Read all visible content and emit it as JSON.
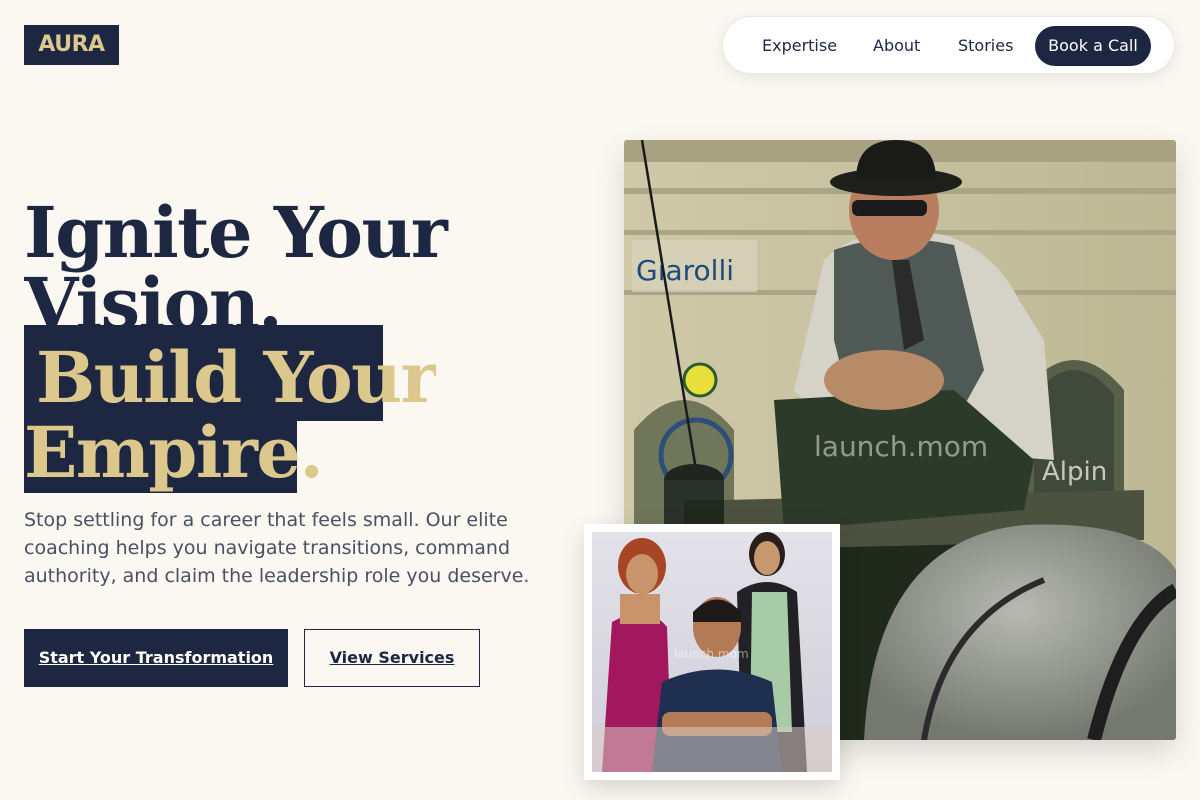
{
  "brand": {
    "logo": "AURA"
  },
  "nav": {
    "items": [
      "Expertise",
      "About",
      "Stories"
    ],
    "cta": "Book a Call"
  },
  "hero": {
    "headline_line1": "Ignite Your",
    "headline_line2": "Vision.",
    "highlight_line1": "Build Your",
    "highlight_line2": "Empire.",
    "description": "Stop settling for a career that feels small. Our elite coaching helps you navigate transitions, command authority, and claim the leadership role you deserve.",
    "primary_button": "Start Your Transformation",
    "secondary_button": "View Services"
  },
  "images": {
    "main_watermark": "launch.mom",
    "main_sign_text": "Giarolli",
    "main_sign_text2": "Alpin",
    "inset_watermark": "launch.mom"
  },
  "colors": {
    "navy": "#1d2741",
    "gold": "#dcc78d",
    "background": "#fbf8f2"
  }
}
